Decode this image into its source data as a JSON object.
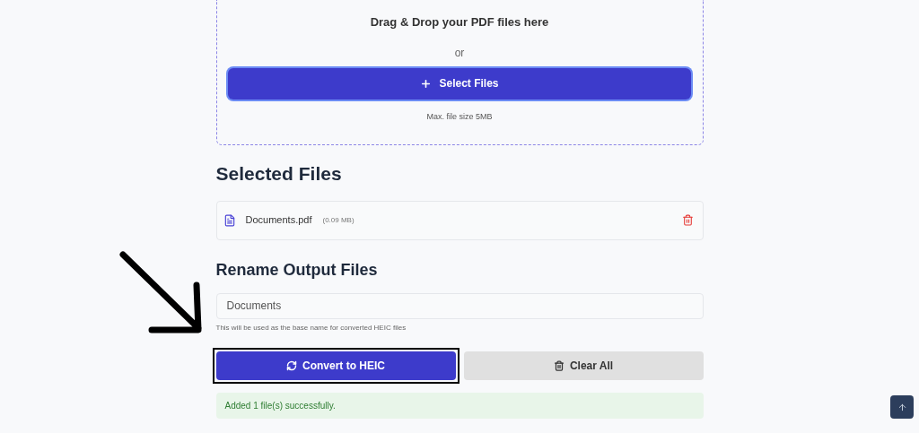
{
  "dropzone": {
    "title": "Drag & Drop your PDF files here",
    "separator": "or",
    "button": "Select Files",
    "hint": "Max. file size 5MB"
  },
  "selected_files": {
    "heading": "Selected Files",
    "files": [
      {
        "name": "Documents.pdf",
        "size": "(0.09 MB)"
      }
    ]
  },
  "rename": {
    "heading": "Rename Output Files",
    "value": "Documents",
    "hint": "This will be used as the base name for converted HEIC files"
  },
  "actions": [
    {
      "label": "Convert to HEIC",
      "kind": "primary",
      "highlighted": true
    },
    {
      "label": "Clear All",
      "kind": "secondary",
      "highlighted": false
    }
  ],
  "message": {
    "text": "Added 1 file(s) successfully.",
    "kind": "success"
  }
}
